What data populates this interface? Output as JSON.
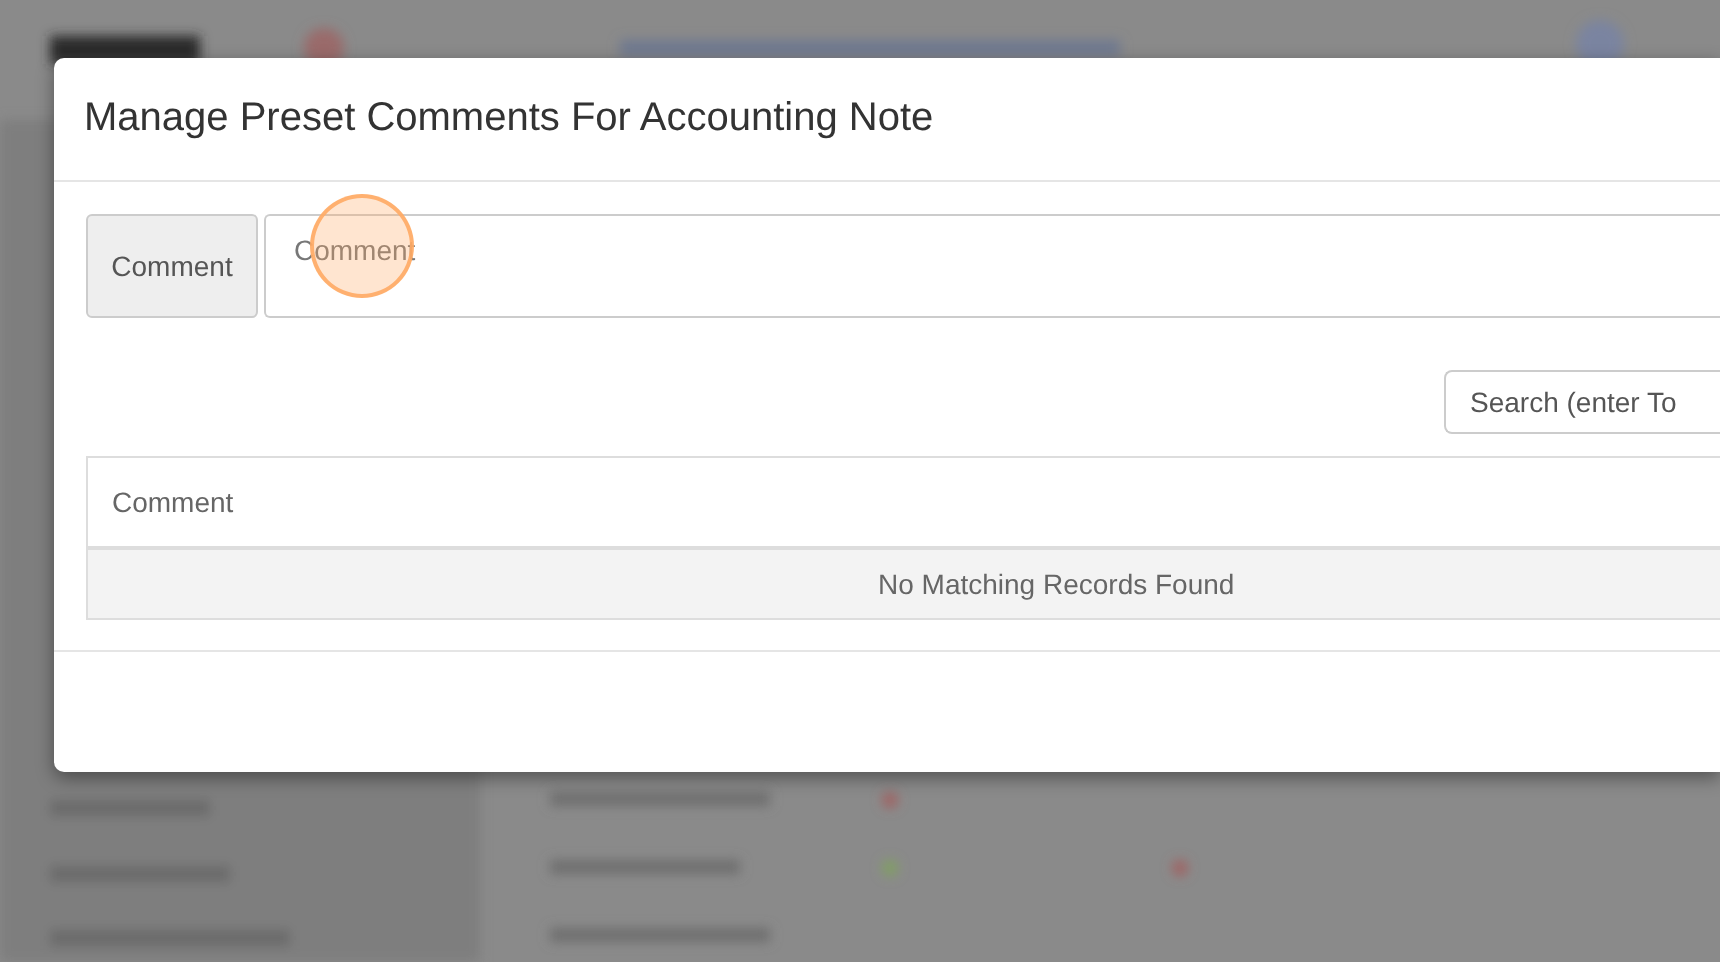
{
  "dialog": {
    "title": "Manage Preset Comments For Accounting Note",
    "comment_input": {
      "label": "Comment",
      "placeholder": "Comment"
    },
    "search": {
      "placeholder": "Search (enter To"
    },
    "table": {
      "columns": [
        "Comment"
      ],
      "empty_message": "No Matching Records Found"
    }
  }
}
